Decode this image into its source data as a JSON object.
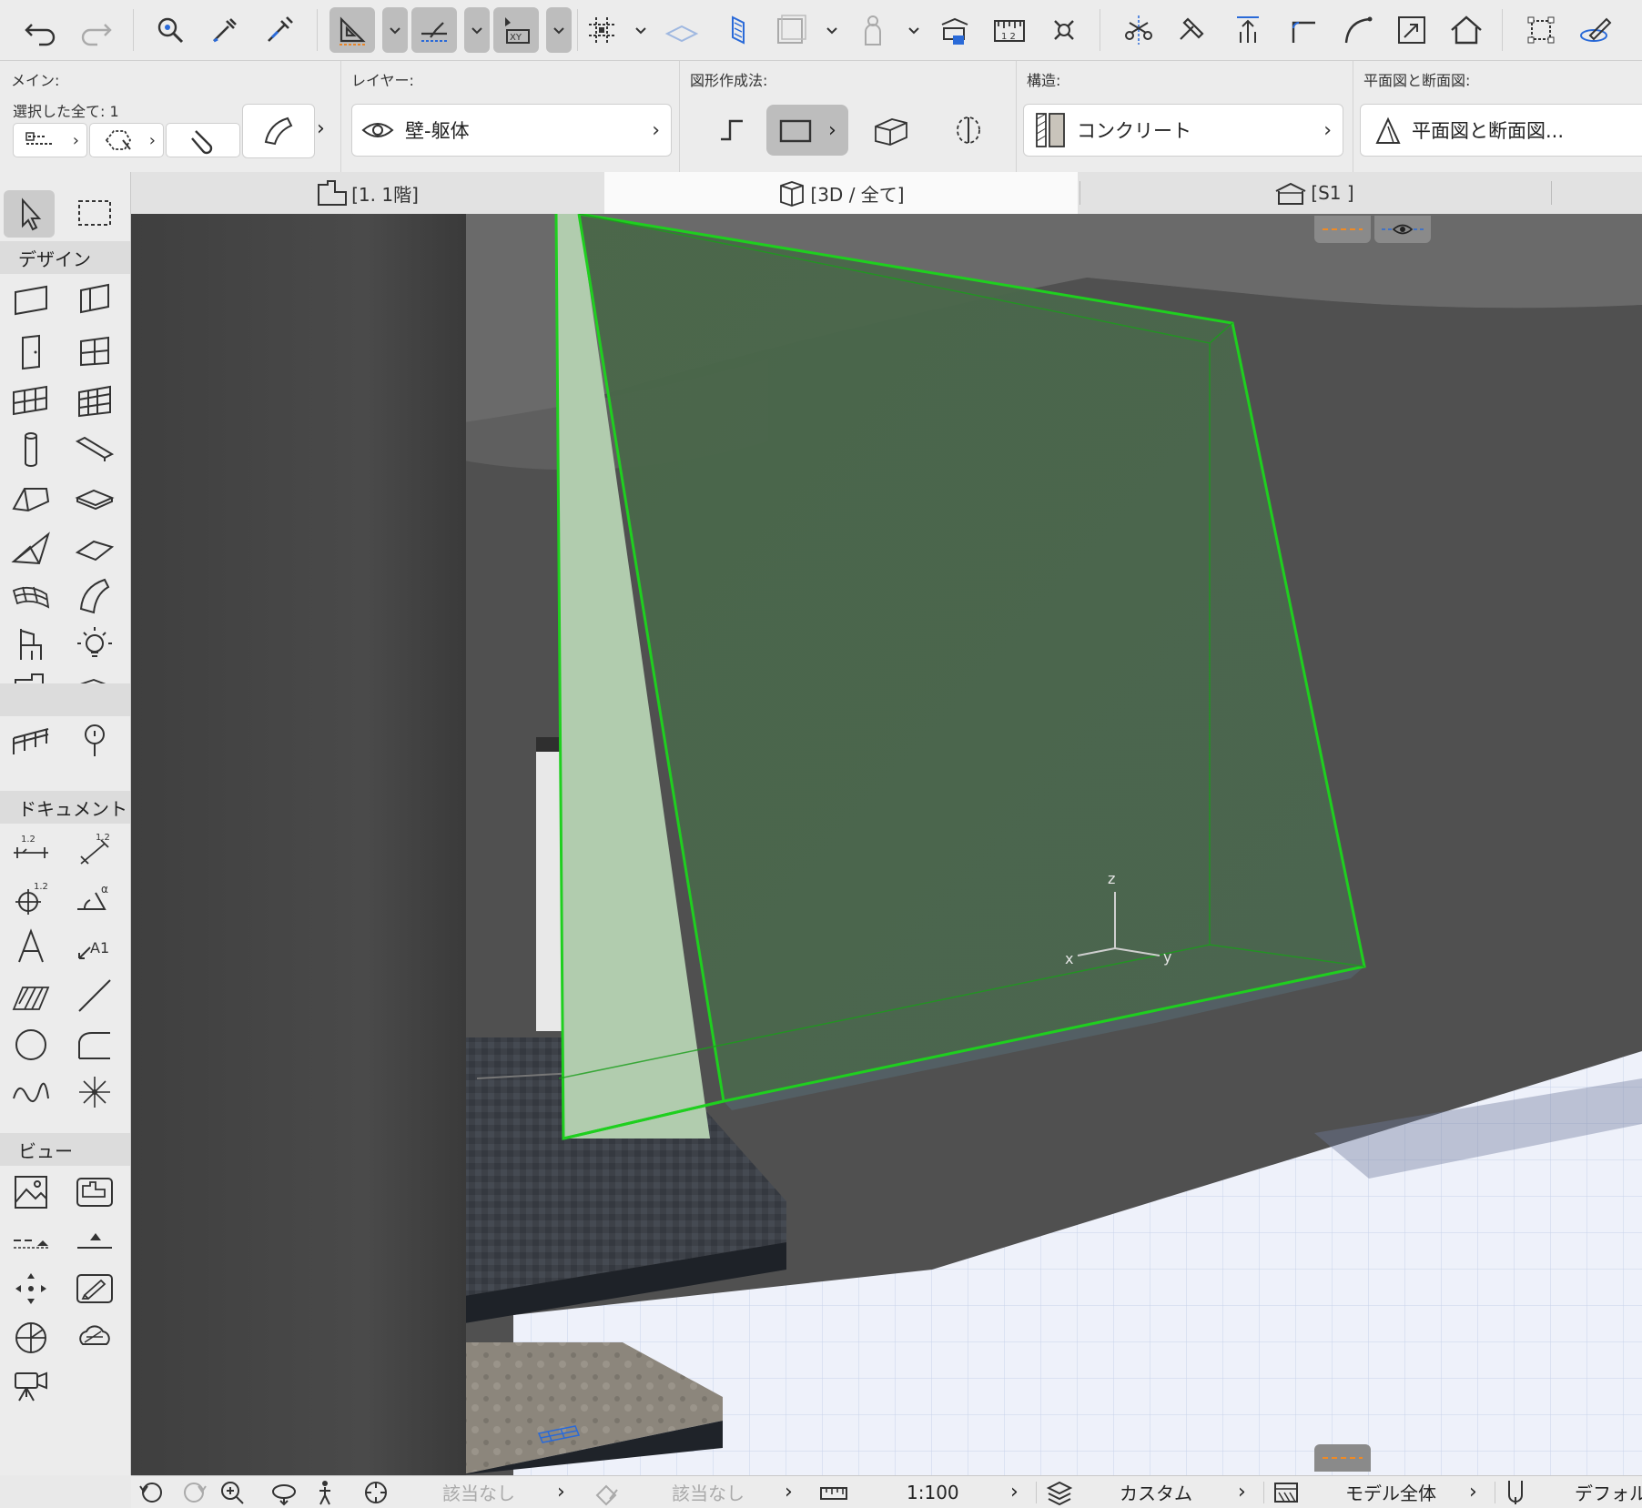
{
  "toolbar": {
    "icons": [
      "undo-icon",
      "redo-icon",
      "find-select-icon",
      "eyedropper-icon",
      "syringe-icon",
      "guide-lines-icon",
      "snap-points-icon",
      "coordinate-input-icon",
      "grid-snap-icon",
      "plane-icon",
      "section-marker-icon",
      "marquee-3d-icon",
      "person-icon",
      "renovation-icon",
      "measure-icon",
      "suspend-groups-icon",
      "split-icon",
      "adjust-icon",
      "elevate-icon",
      "fillet-icon",
      "curve-edit-icon",
      "resize-icon",
      "roof-icon",
      "offset-icon",
      "edit-plane-icon"
    ]
  },
  "infobox": {
    "main_title": "メイン:",
    "selected_text": "選択した全て: 1",
    "layer_title": "レイヤー:",
    "layer_value": "壁-躯体",
    "geometry_title": "図形作成法:",
    "structure_title": "構造:",
    "structure_value": "コンクリート",
    "plan_section_title": "平面図と断面図:",
    "plan_section_value": "平面図と断面図..."
  },
  "tabs": [
    {
      "label": "[1. 1階]",
      "icon": "floor-plan-icon"
    },
    {
      "label": "[3D / 全て]",
      "icon": "cube-3d-icon"
    },
    {
      "label": "[S1 ]",
      "icon": "section-icon"
    }
  ],
  "toolbox": {
    "design_label": "デザイン",
    "document_label": "ドキュメント",
    "view_label": "ビュー"
  },
  "viewport": {
    "axis_x": "x",
    "axis_y": "y",
    "axis_z": "z"
  },
  "statusbar": {
    "none1": "該当なし",
    "none2": "該当なし",
    "scale": "1:100",
    "layer_combo": "カスタム",
    "model_view": "モデル全体",
    "pen_set": "デフォル"
  },
  "colors": {
    "selection": "#1fcf1f",
    "wall_face": "#4e6b4e",
    "wall_edge_face": "#b1ccae",
    "dark_wall": "#4b4b4b",
    "grid_floor": "#eef1fa"
  }
}
